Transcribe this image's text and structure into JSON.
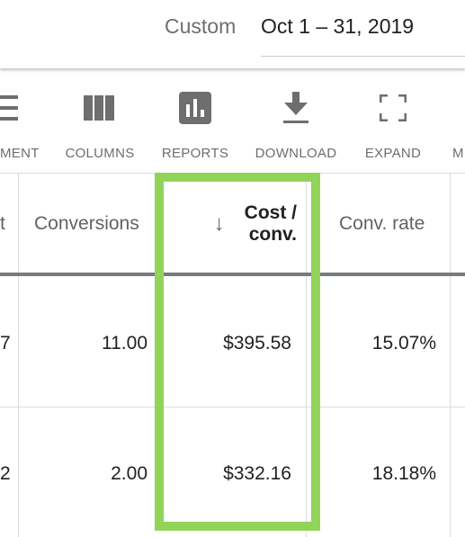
{
  "header": {
    "date_label": "Custom",
    "date_range": "Oct 1 – 31, 2019"
  },
  "toolbar": [
    {
      "label": "MENT",
      "icon": "segment-icon"
    },
    {
      "label": "COLUMNS",
      "icon": "columns-icon"
    },
    {
      "label": "REPORTS",
      "icon": "reports-icon"
    },
    {
      "label": "DOWNLOAD",
      "icon": "download-icon"
    },
    {
      "label": "EXPAND",
      "icon": "expand-icon"
    },
    {
      "label": "M",
      "icon": "more-icon"
    }
  ],
  "table": {
    "columns": [
      "t",
      "Conversions",
      "Cost / conv.",
      "Conv. rate"
    ],
    "sorted_column_line1": "Cost /",
    "sorted_column_line2": "conv.",
    "rows": [
      {
        "prev": "7",
        "conversions": "11.00",
        "cost_conv": "$395.58",
        "conv_rate": "15.07%"
      },
      {
        "prev": "2",
        "conversions": "2.00",
        "cost_conv": "$332.16",
        "conv_rate": "18.18%"
      }
    ]
  },
  "highlight_color": "#92d35a"
}
